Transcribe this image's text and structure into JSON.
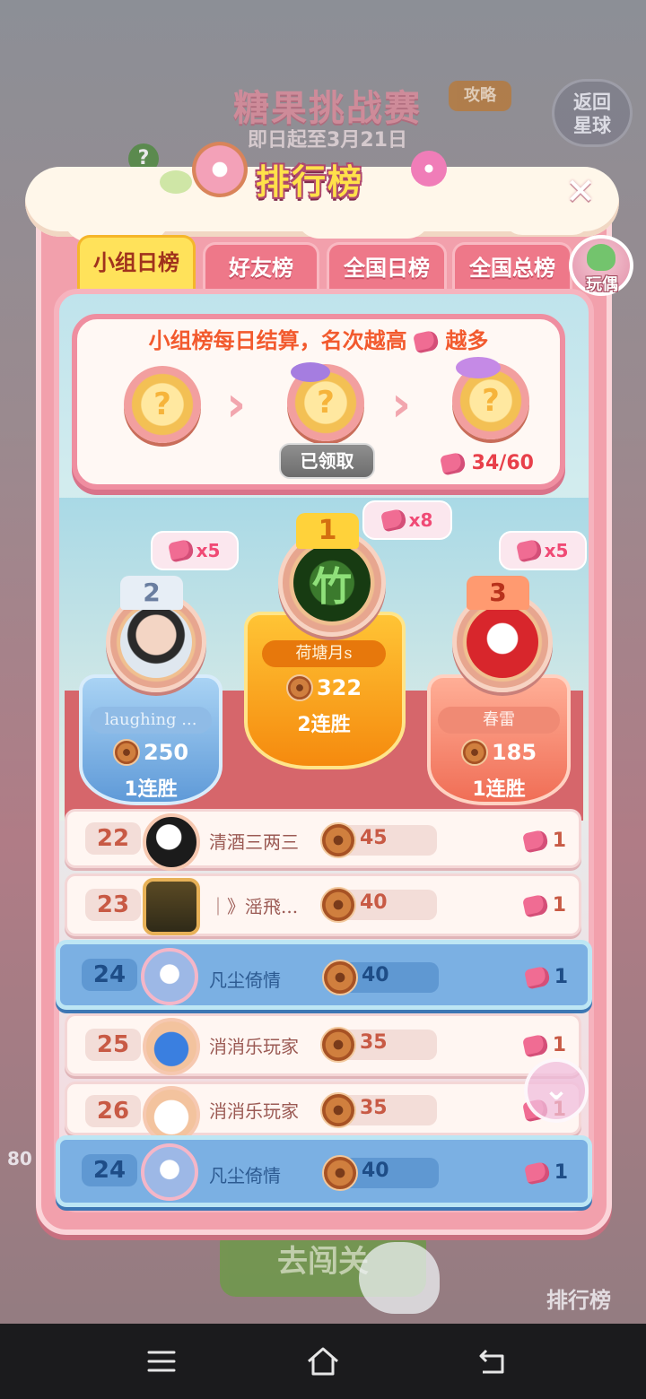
{
  "background": {
    "event_title": "糖果挑战赛",
    "event_dates": "即日起至3月21日",
    "guide_label": "攻略",
    "back_label": "返回\n星球",
    "go_button": "去闯关",
    "rank_button": "排行榜",
    "side_value": "80"
  },
  "panel": {
    "title": "排行榜",
    "close_icon": "close-icon",
    "tabs": [
      {
        "label": "小组日榜",
        "active": true
      },
      {
        "label": "好友榜",
        "active": false
      },
      {
        "label": "全国日榜",
        "active": false
      },
      {
        "label": "全国总榜",
        "active": false
      }
    ],
    "toy_label": "玩偶"
  },
  "reward": {
    "header_before": "小组榜每日结算，名次越高",
    "header_after": "越多",
    "chest_icons": [
      "question-chest-icon",
      "bow-chest-icon",
      "grand-chest-icon"
    ],
    "claimed_label": "已领取",
    "progress": "34",
    "progress_total": "/60"
  },
  "podium": {
    "first": {
      "rank": "1",
      "name": "荷塘月s",
      "score": "322",
      "streak": "2连胜",
      "reward": "x8"
    },
    "second": {
      "rank": "2",
      "name": "laughing ...",
      "score": "250",
      "streak": "1连胜",
      "reward": "x5"
    },
    "third": {
      "rank": "3",
      "name": "春雷",
      "score": "185",
      "streak": "1连胜",
      "reward": "x5"
    }
  },
  "rows": [
    {
      "rank": "22",
      "name": "清酒三两三",
      "score": "45",
      "reward": "1",
      "me": false
    },
    {
      "rank": "23",
      "name": "｜》滛飛...",
      "score": "40",
      "reward": "1",
      "me": false
    },
    {
      "rank": "24",
      "name": "凡尘倚情",
      "score": "40",
      "reward": "1",
      "me": true
    },
    {
      "rank": "25",
      "name": "消消乐玩家",
      "score": "35",
      "reward": "1",
      "me": false
    },
    {
      "rank": "26",
      "name": "消消乐玩家",
      "score": "35",
      "reward": "1",
      "me": false
    }
  ],
  "my_row": {
    "rank": "24",
    "name": "凡尘倚情",
    "score": "40",
    "reward": "1"
  },
  "colors": {
    "panel": "#f2a0ac",
    "tab_active": "#ffe25a",
    "my_row": "#7bb0e3",
    "first_place": "#f9a11b"
  }
}
